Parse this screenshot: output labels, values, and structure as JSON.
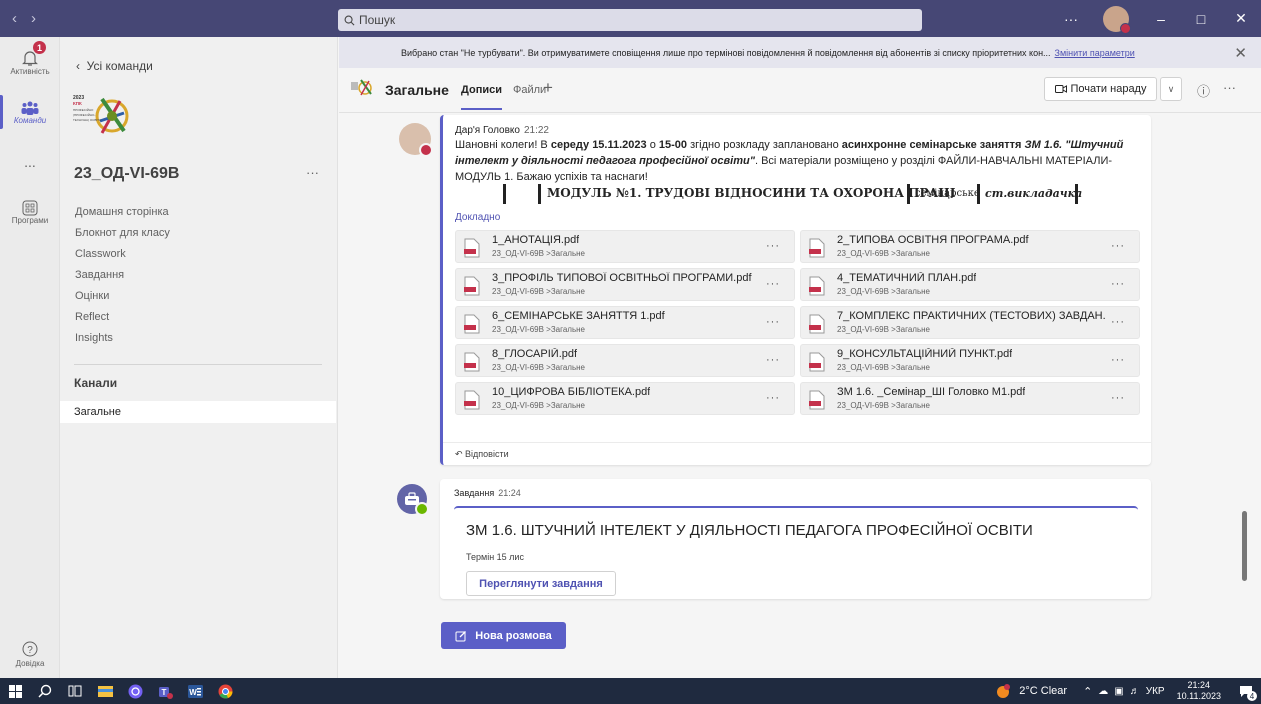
{
  "search": {
    "placeholder": "Пошук"
  },
  "rail": {
    "activity": "Активність",
    "activity_badge": "1",
    "teams": "Команди",
    "more": "...",
    "apps": "Програми",
    "help": "Довідка"
  },
  "sidebar": {
    "back": "Усі команди",
    "team_name": "23_ОД-VI-69В",
    "logo_text": "2023 КПК ПРОФЕСІЙНО (ПРОФЕСІЙНО-ТЕХНІЧНА) ОСВІТА",
    "links": [
      "Домашня сторінка",
      "Блокнот для класу",
      "Classwork",
      "Завдання",
      "Оцінки",
      "Reflect",
      "Insights"
    ],
    "channels_heading": "Канали",
    "selected_channel": "Загальне"
  },
  "notification": {
    "text": "Вибрано стан \"Не турбувати\". Ви отримуватимете сповіщення лише про термінові повідомлення й повідомлення від абонентів зі списку пріоритетних кон...",
    "link": "Змінити параметри"
  },
  "header": {
    "channel": "Загальне",
    "tab_posts": "Дописи",
    "tab_files": "Файли",
    "meet_button": "Почати нараду"
  },
  "post": {
    "author": "Дар'я Головко",
    "time": "21:22",
    "text_1": "Шановні колеги! В ",
    "text_b1": "середу 15.11.2023",
    "text_2": " о ",
    "text_b2": "15-00",
    "text_3": " згідно розкладу заплановано ",
    "text_b3": "асинхронне семінарське заняття",
    "text_4": " ",
    "text_it": "ЗМ 1.6. \"Штучний інтелект у діяльності педагога професійної освіти\"",
    "text_5": ". Всі матеріали розміщено у розділі ФАЙЛИ-НАВЧАЛЬНІ МАТЕРІАЛИ-МОДУЛЬ 1. Бажаю успіхів та наснаги!",
    "preview_heading": "МОДУЛЬ №1. ТРУДОВІ ВІДНОСИНИ ТА ОХОРОНА ПРАЦІ",
    "preview_col1": "семінарське",
    "preview_col2": "ст.викладачка",
    "details": "Докладно",
    "reply": "Відповісти",
    "files": [
      {
        "name": "1_АНОТАЦІЯ.pdf",
        "location": "23_ОД-VI-69В >Загальне"
      },
      {
        "name": "2_ТИПОВА ОСВІТНЯ ПРОГРАМА.pdf",
        "location": "23_ОД-VI-69В >Загальне"
      },
      {
        "name": "3_ПРОФІЛЬ ТИПОВОЇ ОСВІТНЬОЇ ПРОГРАМИ.pdf",
        "location": "23_ОД-VI-69В >Загальне"
      },
      {
        "name": "4_ТЕМАТИЧНИЙ ПЛАН.pdf",
        "location": "23_ОД-VI-69В >Загальне"
      },
      {
        "name": "6_СЕМІНАРСЬКЕ ЗАНЯТТЯ 1.pdf",
        "location": "23_ОД-VI-69В >Загальне"
      },
      {
        "name": "7_КОМПЛЕКС ПРАКТИЧНИХ (ТЕСТОВИХ) ЗАВДАН...",
        "location": "23_ОД-VI-69В >Загальне"
      },
      {
        "name": "8_ГЛОСАРІЙ.pdf",
        "location": "23_ОД-VI-69В >Загальне"
      },
      {
        "name": "9_КОНСУЛЬТАЦІЙНИЙ ПУНКТ.pdf",
        "location": "23_ОД-VI-69В >Загальне"
      },
      {
        "name": "10_ЦИФРОВА БІБЛІОТЕКА.pdf",
        "location": "23_ОД-VI-69В >Загальне"
      },
      {
        "name": "ЗМ 1.6. _Семінар_ШІ Головко М1.pdf",
        "location": "23_ОД-VI-69В >Загальне"
      }
    ]
  },
  "task": {
    "author": "Завдання",
    "time": "21:24",
    "title": "ЗМ 1.6. ШТУЧНИЙ ІНТЕЛЕКТ У ДІЯЛЬНОСТІ ПЕДАГОГА ПРОФЕСІЙНОЇ ОСВІТИ",
    "due": "Термін 15 лис",
    "button": "Переглянути завдання"
  },
  "new_conversation": "Нова розмова",
  "taskbar": {
    "weather": "2°C Clear",
    "lang": "УКР",
    "time": "21:24",
    "date": "10.11.2023",
    "notif_count": "4"
  },
  "colors": {
    "titlebar": "#464775",
    "accent": "#5b5fc7",
    "taskbar": "#1f2a3f",
    "pdf_red": "#c4314b"
  }
}
